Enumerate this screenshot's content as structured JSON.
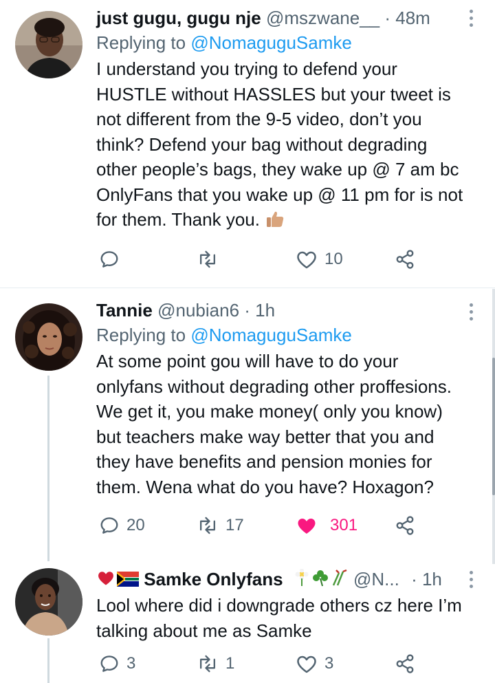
{
  "tweets": [
    {
      "name": "just gugu, gugu nje",
      "handle": "@mszwane__",
      "time": "· 48m",
      "replying_prefix": "Replying to",
      "replying_to": "@NomaguguSamke",
      "lines": [
        "I understand you trying to defend your",
        "HUSTLE without HASSLES but your tweet is",
        "not different from the 9-5 video, don’t you",
        "think? Defend your bag without degrading",
        "other people’s bags, they wake up @ 7 am bc",
        "OnlyFans that you wake up @ 11 pm for is not",
        "for them. Thank you."
      ],
      "trailing_emoji": "thumbs-up-icon",
      "replies": "",
      "retweets": "",
      "likes": "10",
      "liked": false
    },
    {
      "name": "Tannie",
      "handle": "@nubian6",
      "time": "· 1h",
      "replying_prefix": "Replying to",
      "replying_to": "@NomaguguSamke",
      "lines": [
        "At some point gou will have to do your",
        "onlyfans without degrading other proffesions.",
        "We get it, you make money( only you know)",
        "but teachers make way better that you and",
        "they have benefits and pension monies for",
        "them. Wena what do you have? Hoxagon?"
      ],
      "replies": "20",
      "retweets": "17",
      "likes": "301",
      "liked": true
    },
    {
      "name": "Samke Onlyfans",
      "name_prefix_icons": [
        "heart-icon",
        "south-africa-flag-icon"
      ],
      "name_suffix_icons": [
        "flower-icon",
        "shamrock-icon",
        "plant-icon"
      ],
      "handle": "@N...",
      "time": "· 1h",
      "lines": [
        "Lool where did i downgrade others cz here I’m",
        "talking about me as Samke"
      ],
      "replies": "3",
      "retweets": "1",
      "likes": "3",
      "liked": false
    }
  ],
  "colors": {
    "text": "#0f1419",
    "muted": "#536471",
    "link": "#1d9bf0",
    "like_active": "#f91880",
    "divider": "#e6ecf0"
  }
}
